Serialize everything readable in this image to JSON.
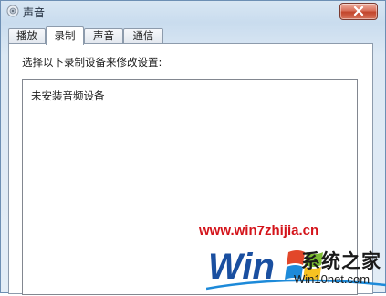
{
  "window": {
    "title": "声音",
    "icon": "speaker-icon",
    "close_icon": "close-icon"
  },
  "tabs": [
    {
      "label": "播放",
      "active": false
    },
    {
      "label": "录制",
      "active": true
    },
    {
      "label": "声音",
      "active": false
    },
    {
      "label": "通信",
      "active": false
    }
  ],
  "panel": {
    "instruction": "选择以下录制设备来修改设置:",
    "empty_message": "未安装音频设备"
  },
  "watermark": {
    "url": "www.win7zhijia.cn",
    "logo_text": "Win7",
    "brand": "系统之家",
    "site": "Win10net.com"
  },
  "colors": {
    "close_button": "#c2452c",
    "watermark_red": "#d4141b",
    "logo_blue": "#1a4fa0"
  }
}
